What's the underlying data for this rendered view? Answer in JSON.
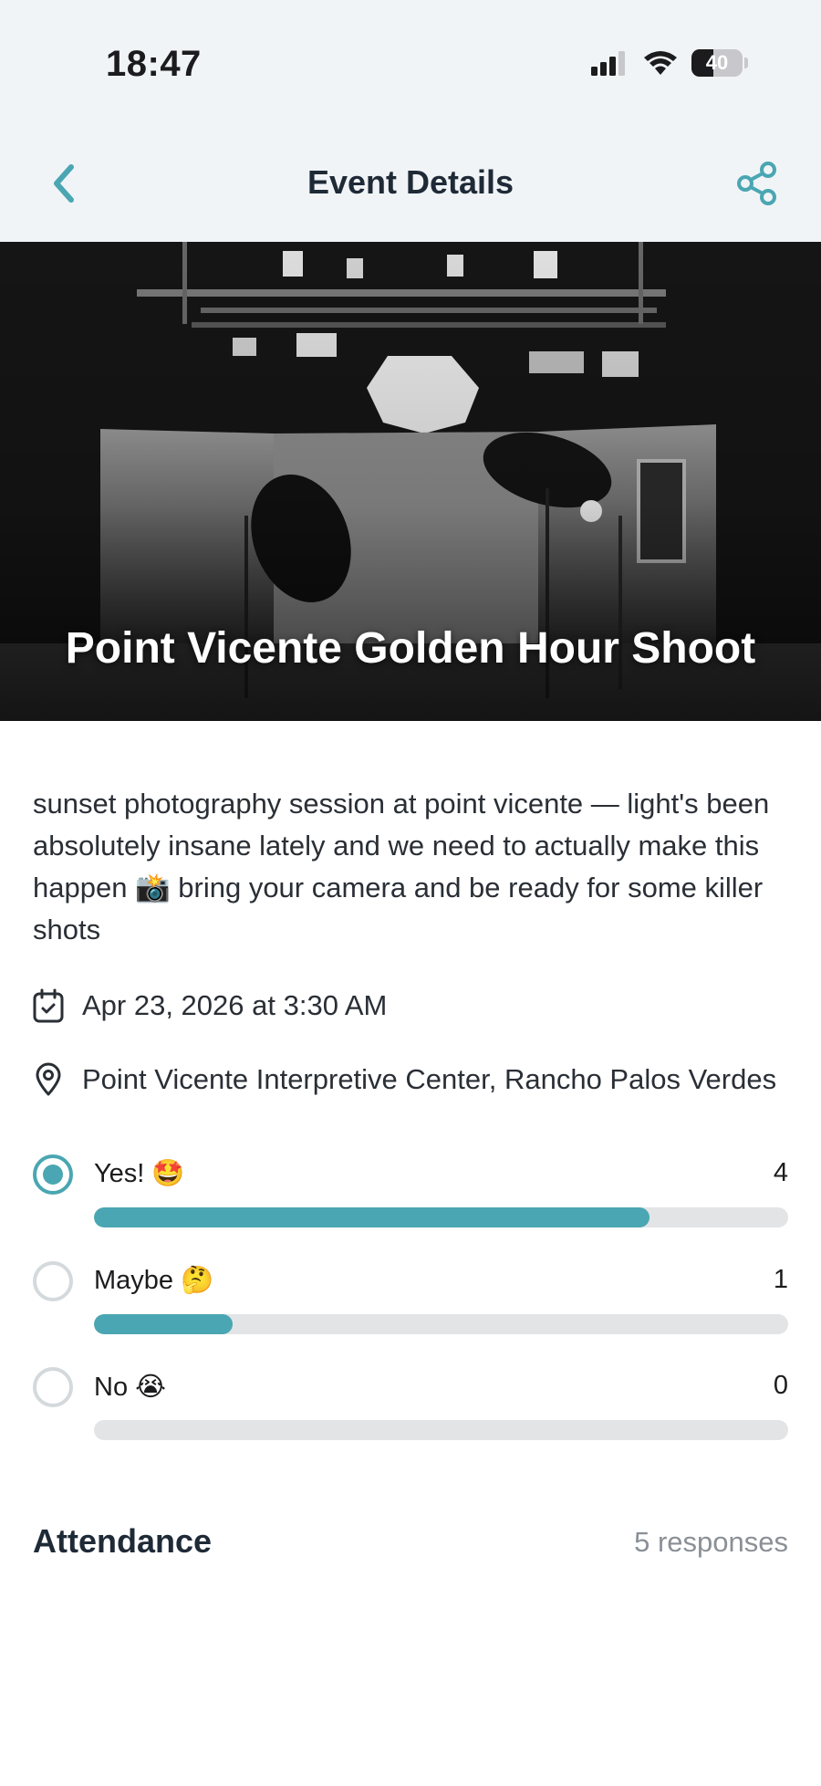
{
  "status_bar": {
    "time": "18:47",
    "battery": "40"
  },
  "nav": {
    "title": "Event Details",
    "back_icon": "chevron-left-icon",
    "share_icon": "share-icon"
  },
  "event": {
    "title": "Point Vicente Golden Hour Shoot",
    "description": "sunset photography session at point vicente — light's been absolutely insane lately and we need to actually make this happen 📸 bring your camera and be ready for some killer shots",
    "date": "Apr 23, 2026 at 3:30 AM",
    "location": "Point Vicente Interpretive Center, Rancho Palos Verdes"
  },
  "rsvp": {
    "options": [
      {
        "label": "Yes! 🤩",
        "count": "4",
        "fraction": 0.8,
        "selected": true
      },
      {
        "label": "Maybe 🤔",
        "count": "1",
        "fraction": 0.2,
        "selected": false
      },
      {
        "label": "No 😭",
        "count": "0",
        "fraction": 0,
        "selected": false
      }
    ]
  },
  "attendance": {
    "title": "Attendance",
    "responses": "5 responses"
  },
  "colors": {
    "accent": "#4aa6b2",
    "track": "#e2e4e6",
    "header_bg": "#f1f4f7"
  }
}
